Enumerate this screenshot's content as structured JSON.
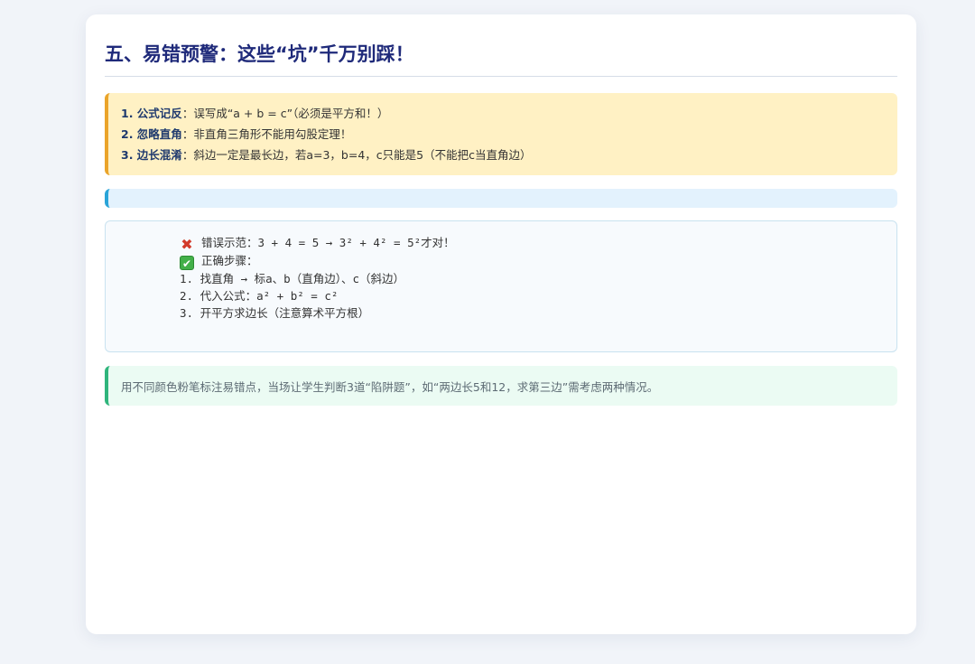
{
  "section": {
    "title": "五、易错预警：这些“坑”千万别踩！"
  },
  "warnings": [
    {
      "label": "1. 公式记反",
      "sep": "：",
      "text": "误写成“a + b = c”（必须是平方和！）"
    },
    {
      "label": "2. 忽略直角",
      "sep": "：",
      "text": "非直角三角形不能用勾股定理！"
    },
    {
      "label": "3. 边长混淆",
      "sep": "：",
      "text": "斜边一定是最长边，若a=3，b=4，c只能是5（不能把c当直角边）"
    }
  ],
  "code": {
    "wrong": "错误示范：3 + 4 = 5 → 3² + 4² = 5²才对！",
    "right": "正确步骤：",
    "steps": [
      "1. 找直角 → 标a、b（直角边）、c（斜边）",
      "2. 代入公式：a² + b² = c²",
      "3. 开平方求边长（注意算术平方根）"
    ],
    "icons": {
      "wrong": "cross-icon",
      "right": "check-icon"
    }
  },
  "tip": {
    "text": "用不同颜色粉笔标注易错点，当场让学生判断3道“陷阱题”，如“两边长5和12，求第三边”需考虑两种情况。"
  },
  "colors": {
    "title": "#1f2a7a",
    "warn_bg": "#fff1c4",
    "warn_border": "#eaa42a",
    "info_border": "#2aa4d8",
    "tip_border": "#2fb57c"
  }
}
